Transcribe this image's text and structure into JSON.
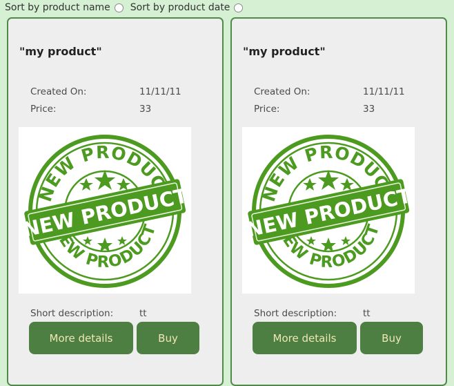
{
  "sort": {
    "by_name_label": "Sort by product name",
    "by_date_label": "Sort by product date"
  },
  "products": [
    {
      "title": "\"my product\"",
      "created_label": "Created On:",
      "created_value": "11/11/11",
      "price_label": "Price:",
      "price_value": "33",
      "image": {
        "stamp_top_text": "NEW PRODUCT",
        "stamp_center_text": "NEW PRODUCT",
        "stamp_bottom_text": "NEW PRODUCT",
        "color": "#4c9a1f"
      },
      "desc_label": "Short description:",
      "desc_value": "tt",
      "details_button": "More details",
      "buy_button": "Buy"
    },
    {
      "title": "\"my product\"",
      "created_label": "Created On:",
      "created_value": "11/11/11",
      "price_label": "Price:",
      "price_value": "33",
      "image": {
        "stamp_top_text": "NEW PRODUCT",
        "stamp_center_text": "NEW PRODUCT",
        "stamp_bottom_text": "NEW PRODUCT",
        "color": "#4c9a1f"
      },
      "desc_label": "Short description:",
      "desc_value": "tt",
      "details_button": "More details",
      "buy_button": "Buy"
    }
  ],
  "colors": {
    "page_bg": "#d6f0d4",
    "card_bg": "#eeeeee",
    "card_border": "#4f8a49",
    "button_bg": "#4e7f42",
    "button_text": "#f1e7b6"
  }
}
